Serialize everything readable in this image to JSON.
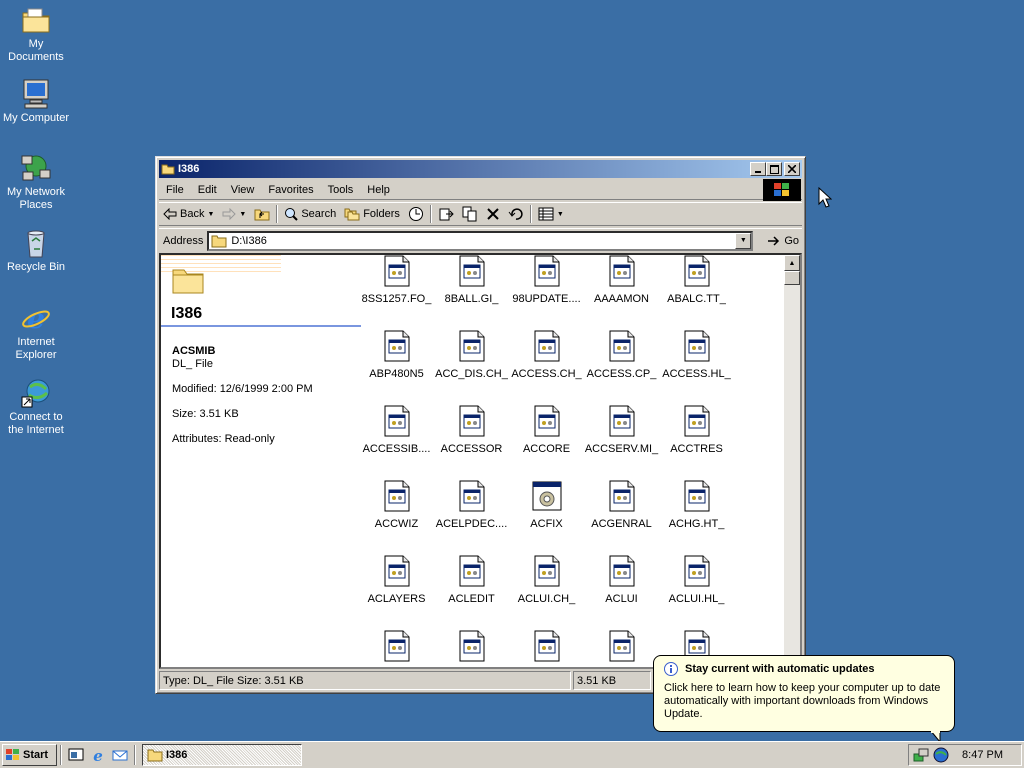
{
  "desktop": {
    "icons": [
      {
        "label": "My Documents",
        "icon": "folder-documents-icon"
      },
      {
        "label": "My Computer",
        "icon": "computer-icon"
      },
      {
        "label": "My Network Places",
        "icon": "network-icon"
      },
      {
        "label": "Recycle Bin",
        "icon": "recycle-bin-icon"
      },
      {
        "label": "Internet Explorer",
        "icon": "ie-icon"
      },
      {
        "label": "Connect to the Internet",
        "icon": "connect-icon"
      }
    ]
  },
  "window": {
    "title": "I386",
    "menu": [
      "File",
      "Edit",
      "View",
      "Favorites",
      "Tools",
      "Help"
    ],
    "toolbar": {
      "back": "Back",
      "search": "Search",
      "folders": "Folders"
    },
    "address": {
      "label": "Address",
      "value": "D:\\I386",
      "go": "Go"
    },
    "left_pane": {
      "folder_title": "I386",
      "file_name": "ACSMIB",
      "file_type": "DL_ File",
      "modified": "Modified: 12/6/1999 2:00 PM",
      "size": "Size: 3.51 KB",
      "attributes": "Attributes: Read-only"
    },
    "files": [
      "8SS1257.FO_",
      "8BALL.GI_",
      "98UPDATE....",
      "AAAAMON",
      "ABALC.TT_",
      "ABP480N5",
      "ACC_DIS.CH_",
      "ACCESS.CH_",
      "ACCESS.CP_",
      "ACCESS.HL_",
      "ACCESSIB....",
      "ACCESSOR",
      "ACCORE",
      "ACCSERV.MI_",
      "ACCTRES",
      "ACCWIZ",
      "ACELPDEC....",
      "ACFIX",
      "ACGENRAL",
      "ACHG.HT_",
      "ACLAYERS",
      "ACLEDIT",
      "ACLUI.CH_",
      "ACLUI",
      "ACLUI.HL_"
    ],
    "status": {
      "left": "Type: DL_ File Size: 3.51 KB",
      "middle": "3.51 KB"
    }
  },
  "balloon": {
    "title": "Stay current with automatic updates",
    "body": "Click here to learn how to keep your computer up to date automatically with important downloads from Windows Update."
  },
  "taskbar": {
    "start": "Start",
    "task": "I386",
    "clock": "8:47 PM"
  }
}
